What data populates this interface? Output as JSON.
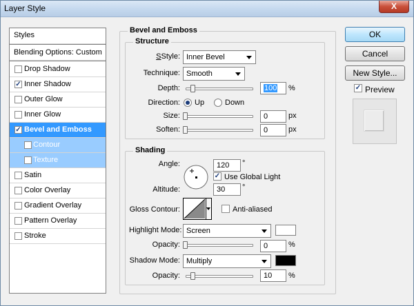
{
  "window": {
    "title": "Layer Style",
    "close_glyph": "X"
  },
  "styles_list": {
    "header": "Styles",
    "blending": "Blending Options: Custom",
    "items": [
      {
        "label": "Drop Shadow",
        "checked": false
      },
      {
        "label": "Inner Shadow",
        "checked": true
      },
      {
        "label": "Outer Glow",
        "checked": false
      },
      {
        "label": "Inner Glow",
        "checked": false
      },
      {
        "label": "Bevel and Emboss",
        "checked": true,
        "selected": true
      },
      {
        "label": "Contour",
        "checked": false,
        "sub": true
      },
      {
        "label": "Texture",
        "checked": false,
        "sub": true
      },
      {
        "label": "Satin",
        "checked": false
      },
      {
        "label": "Color Overlay",
        "checked": false
      },
      {
        "label": "Gradient Overlay",
        "checked": false
      },
      {
        "label": "Pattern Overlay",
        "checked": false
      },
      {
        "label": "Stroke",
        "checked": false
      }
    ]
  },
  "bevel": {
    "title": "Bevel and Emboss",
    "structure": {
      "title": "Structure",
      "style_label": "Style:",
      "style_value": "Inner Bevel",
      "technique_label": "Technique:",
      "technique_value": "Smooth",
      "depth_label": "Depth:",
      "depth_value": "100",
      "depth_unit": "%",
      "direction_label": "Direction:",
      "dir_up": "Up",
      "dir_down": "Down",
      "size_label": "Size:",
      "size_value": "0",
      "size_unit": "px",
      "soften_label": "Soften:",
      "soften_value": "0",
      "soften_unit": "px"
    },
    "shading": {
      "title": "Shading",
      "angle_label": "Angle:",
      "angle_value": "120",
      "angle_unit": "°",
      "global_light_label": "Use Global Light",
      "global_light_checked": true,
      "altitude_label": "Altitude:",
      "altitude_value": "30",
      "altitude_unit": "°",
      "gloss_label": "Gloss Contour:",
      "anti_aliased_label": "Anti-aliased",
      "highlight_label": "Highlight Mode:",
      "highlight_value": "Screen",
      "highlight_color": "#ffffff",
      "h_opacity_label": "Opacity:",
      "h_opacity_value": "0",
      "h_opacity_unit": "%",
      "shadow_label": "Shadow Mode:",
      "shadow_value": "Multiply",
      "shadow_color": "#000000",
      "s_opacity_label": "Opacity:",
      "s_opacity_value": "10",
      "s_opacity_unit": "%"
    }
  },
  "buttons": {
    "ok": "OK",
    "cancel": "Cancel",
    "new_style": "New Style...",
    "preview": "Preview",
    "preview_checked": true
  }
}
